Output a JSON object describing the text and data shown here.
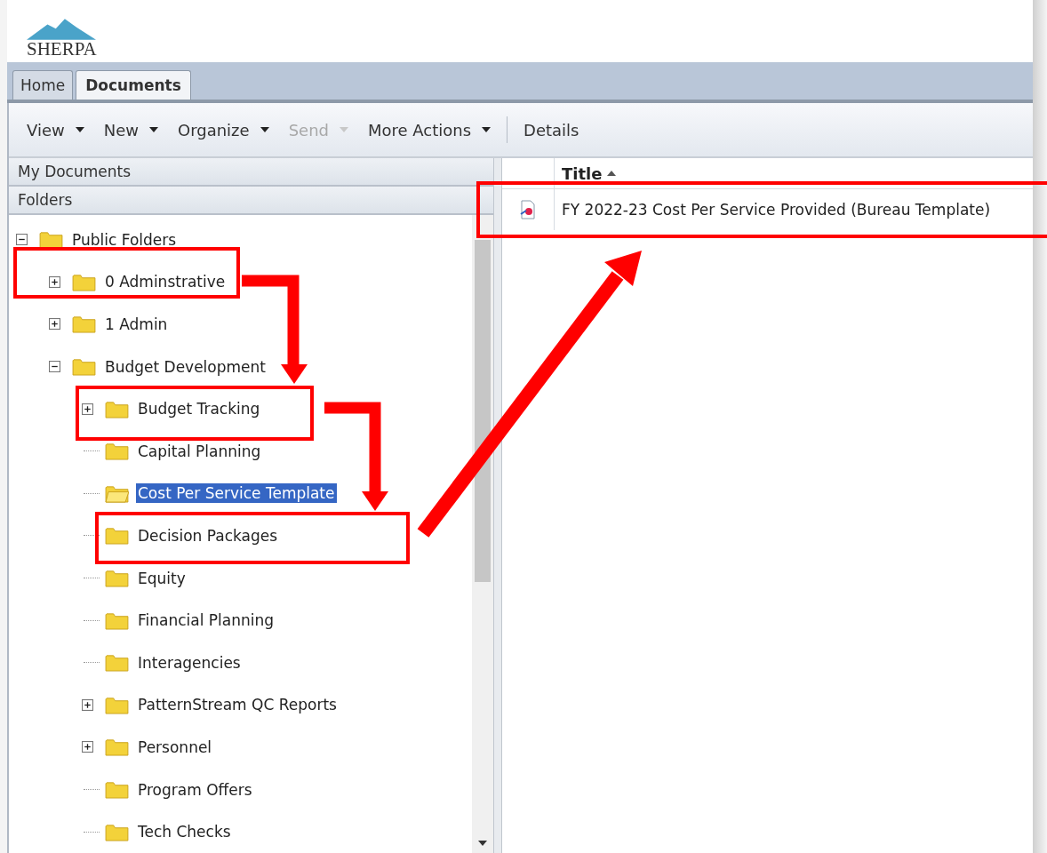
{
  "logo": {
    "name": "SHERPA"
  },
  "tabs": [
    {
      "label": "Home",
      "selected": false
    },
    {
      "label": "Documents",
      "selected": true
    }
  ],
  "toolbar": [
    {
      "label": "View",
      "kind": "menu",
      "disabled": false
    },
    {
      "label": "New",
      "kind": "menu",
      "disabled": false
    },
    {
      "label": "Organize",
      "kind": "menu",
      "disabled": false
    },
    {
      "label": "Send",
      "kind": "menu",
      "disabled": true
    },
    {
      "label": "More Actions",
      "kind": "menu",
      "disabled": false
    },
    {
      "label": "Details",
      "kind": "button",
      "disabled": false
    }
  ],
  "sidebar": {
    "sections": [
      "My Documents",
      "Folders"
    ],
    "tree": [
      {
        "label": "Public Folders",
        "expanded": true,
        "selected": false,
        "children": [
          {
            "label": "0 Adminstrative",
            "expanded": false,
            "selected": false
          },
          {
            "label": "1 Admin",
            "expanded": false,
            "selected": false
          },
          {
            "label": "Budget Development",
            "expanded": true,
            "selected": false,
            "children": [
              {
                "label": "Budget Tracking",
                "expanded": false,
                "selected": false
              },
              {
                "label": "Capital Planning",
                "selected": false
              },
              {
                "label": "Cost Per Service Template",
                "selected": true
              },
              {
                "label": "Decision Packages",
                "selected": false
              },
              {
                "label": "Equity",
                "selected": false
              },
              {
                "label": "Financial Planning",
                "selected": false
              },
              {
                "label": "Interagencies",
                "selected": false
              },
              {
                "label": "PatternStream QC Reports",
                "expanded": false,
                "selected": false
              },
              {
                "label": "Personnel",
                "expanded": false,
                "selected": false
              },
              {
                "label": "Program Offers",
                "selected": false
              },
              {
                "label": "Tech Checks",
                "selected": false
              }
            ]
          }
        ]
      }
    ]
  },
  "table": {
    "columns": [
      {
        "label": "Title"
      }
    ],
    "rows": [
      {
        "title": "FY 2022-23 Cost Per Service Provided (Bureau Template)"
      }
    ]
  }
}
